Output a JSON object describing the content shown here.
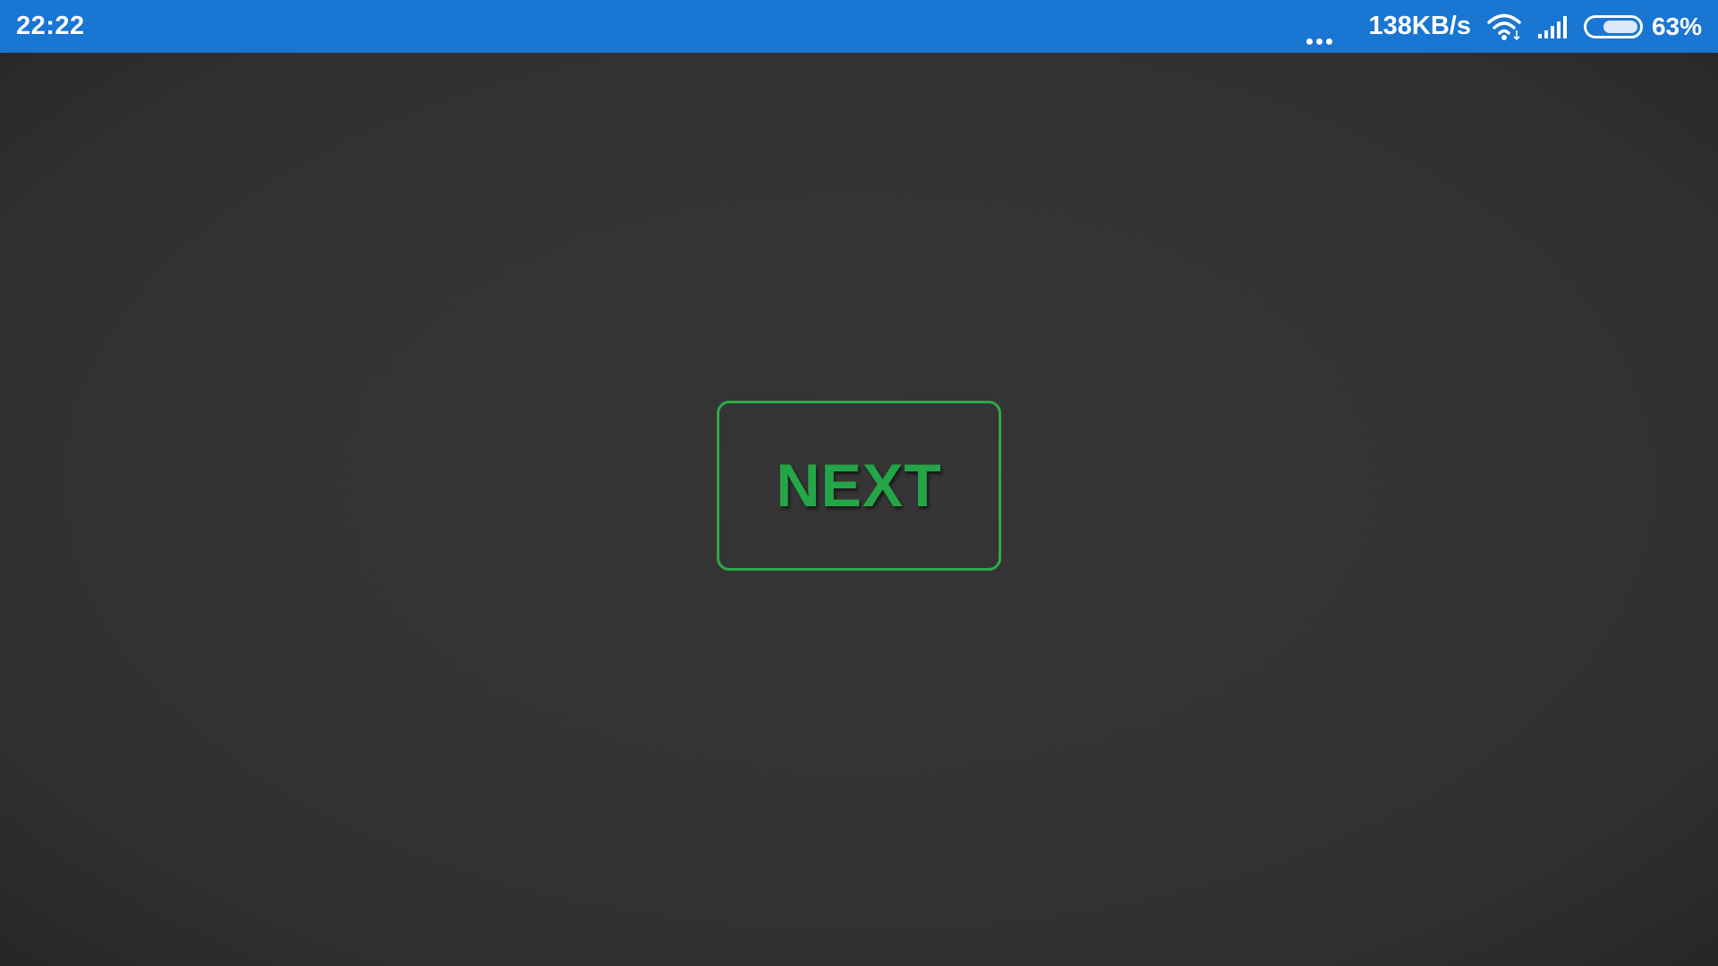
{
  "status_bar": {
    "time": "22:22",
    "net_speed": "138KB/s",
    "battery_percent_text": "63%",
    "battery_level": 0.63,
    "icons": [
      "more-dots-icon",
      "wifi-icon",
      "signal-icon",
      "battery-icon"
    ],
    "background_color": "#1976d2"
  },
  "main": {
    "next_button_label": "NEXT",
    "accent_color": "#24a547",
    "background_color": "#333333"
  }
}
